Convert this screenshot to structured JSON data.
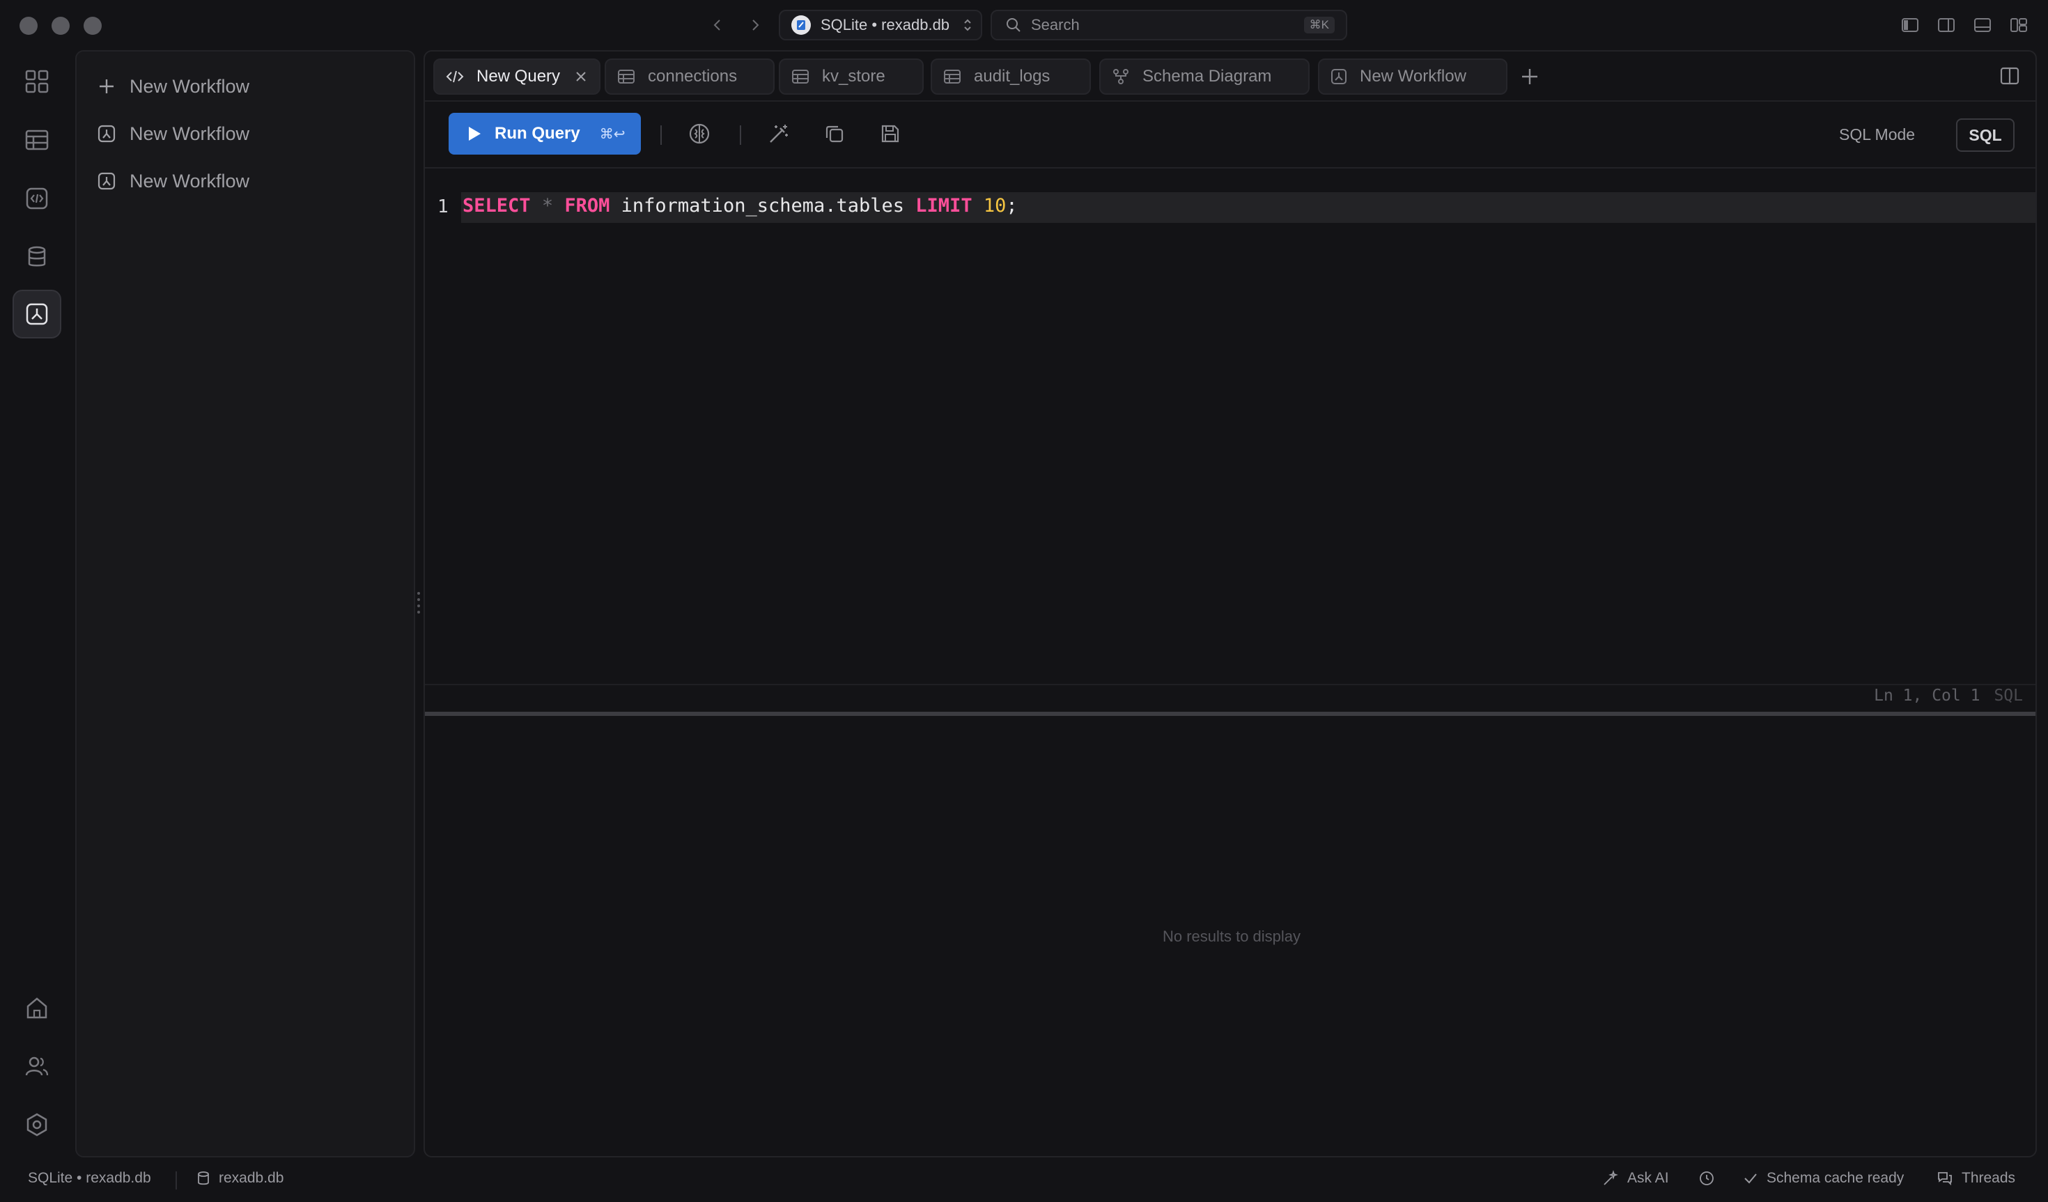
{
  "titlebar": {
    "connection_label": "SQLite • rexadb.db",
    "search_placeholder": "Search",
    "search_shortcut": "⌘K"
  },
  "sidebar": {
    "items": [
      {
        "label": "New Workflow",
        "icon": "plus-icon"
      },
      {
        "label": "New Workflow",
        "icon": "workflow-icon"
      },
      {
        "label": "New Workflow",
        "icon": "workflow-icon"
      }
    ]
  },
  "tabs": [
    {
      "label": "New Query",
      "icon": "code-icon",
      "active": true
    },
    {
      "label": "connections",
      "icon": "table-icon"
    },
    {
      "label": "kv_store",
      "icon": "table-icon"
    },
    {
      "label": "audit_logs",
      "icon": "table-icon"
    },
    {
      "label": "Schema Diagram",
      "icon": "diagram-icon"
    },
    {
      "label": "New Workflow",
      "icon": "workflow-icon"
    }
  ],
  "toolbar": {
    "run_label": "Run Query",
    "run_shortcut": "⌘↩",
    "mode_label": "SQL Mode",
    "mode_badge": "SQL"
  },
  "editor": {
    "line_number": "1",
    "tokens": {
      "select": "SELECT",
      "star": "*",
      "from": "FROM",
      "table": "information_schema.tables",
      "limit": "LIMIT",
      "number": "10",
      "semi": ";"
    },
    "cursor_position": "Ln 1, Col 1",
    "language": "SQL"
  },
  "results": {
    "empty_text": "No results to display"
  },
  "statusbar": {
    "connection": "SQLite • rexadb.db",
    "database": "rexadb.db",
    "ask_ai": "Ask AI",
    "schema_status": "Schema cache ready",
    "threads": "Threads"
  },
  "colors": {
    "accent": "#2d6fd0",
    "keyword": "#ff4f9a",
    "number": "#f5c542",
    "background": "#131316"
  }
}
